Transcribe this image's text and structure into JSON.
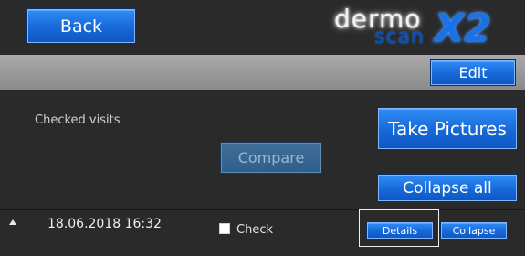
{
  "header": {
    "back_label": "Back",
    "logo": {
      "word1": "dermo",
      "word2": "scan",
      "word3": "X2"
    }
  },
  "toolbar": {
    "edit_label": "Edit"
  },
  "main": {
    "checked_visits_label": "Checked visits",
    "take_pictures_label": "Take Pictures",
    "compare_label": "Compare",
    "collapse_all_label": "Collapse all"
  },
  "visit": {
    "datetime": "18.06.2018  16:32",
    "check_label": "Check",
    "details_label": "Details",
    "collapse_label": "Collapse"
  },
  "colors": {
    "button_blue": "#1769d8",
    "background": "#2a2a2a",
    "toolbar_gray": "#9a9a9a"
  }
}
